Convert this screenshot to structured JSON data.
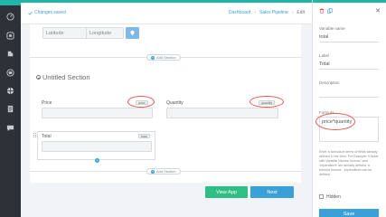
{
  "topbar": {
    "saved_text": "Changes saved",
    "breadcrumb": [
      "Dashboard",
      "Sales Pipeline",
      "Edit"
    ]
  },
  "location": {
    "latitude_placeholder": "Latitude",
    "longitude_placeholder": "Longitude"
  },
  "add_section_label": "Add Section",
  "section": {
    "title": "Untitled Section",
    "fields": {
      "price": {
        "label": "Price",
        "tag": "price"
      },
      "quantity": {
        "label": "Quantity",
        "tag": "quantity"
      },
      "total": {
        "label": "Total",
        "tag": "total"
      }
    }
  },
  "buttons": {
    "view_app": "View App",
    "next": "Next"
  },
  "panel": {
    "variable_name_label": "Variable name",
    "variable_name_value": "total",
    "label_label": "Label",
    "label_value": "Total",
    "description_label": "Description",
    "formula_label": "Formula",
    "formula_value": "price*quantity",
    "help_text": "Enter a formula in terms of fields already defined in the form. For Example: if fields with Variable Names 'income' and 'expenditure' are already defined, a formula income - expenditure can be defined.",
    "hidden_label": "Hidden",
    "save_label": "Save"
  },
  "colors": {
    "accent_teal": "#1fb5a8",
    "primary_blue": "#3aa0d8",
    "view_green": "#2fbf86",
    "highlight_red": "#e05a4f"
  }
}
